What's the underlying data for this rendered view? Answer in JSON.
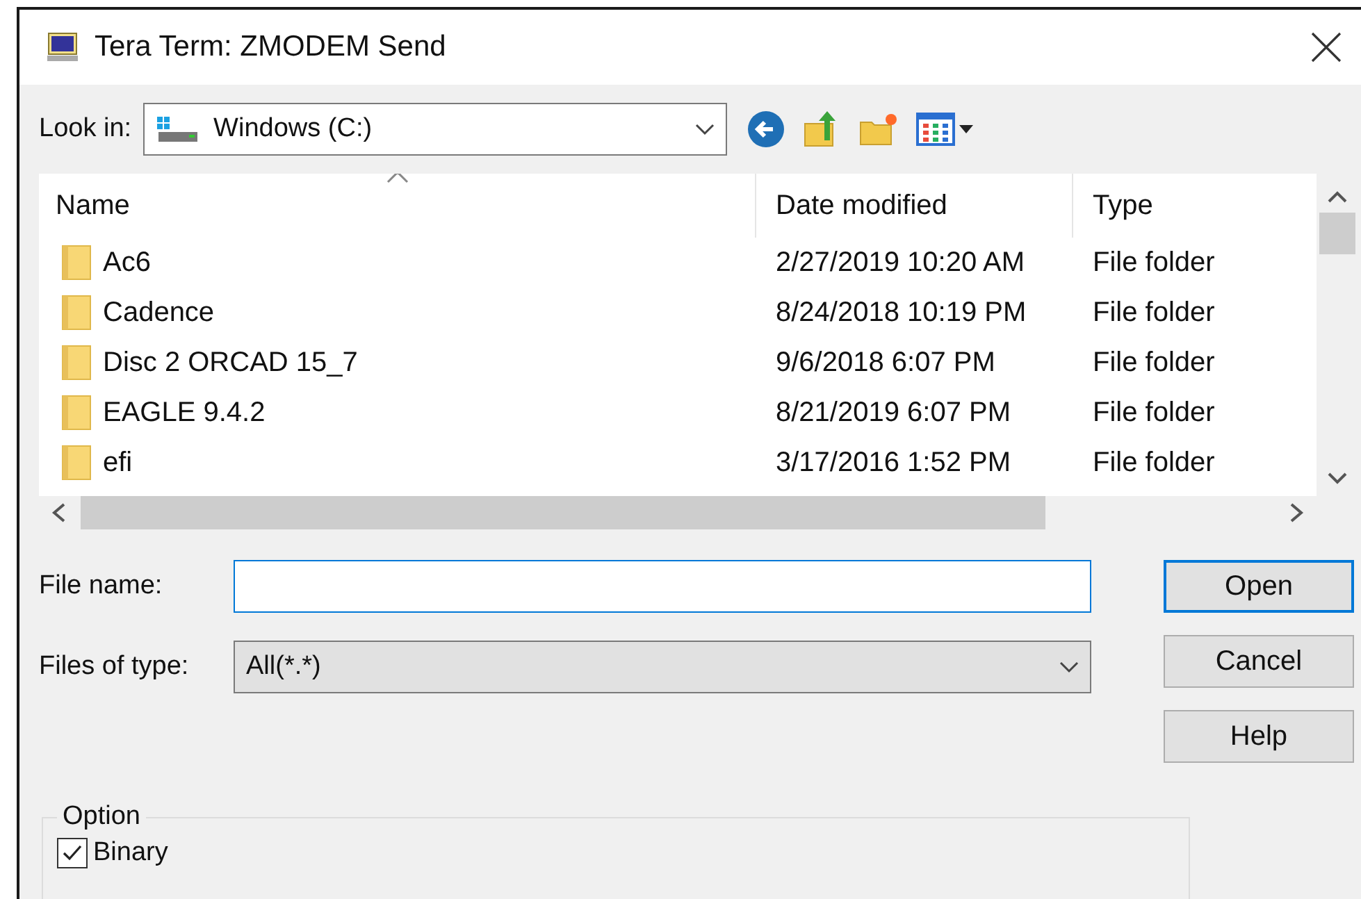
{
  "window": {
    "title": "Tera Term: ZMODEM Send"
  },
  "look_in": {
    "label": "Look in:",
    "value": "Windows (C:)"
  },
  "columns": [
    "Name",
    "Date modified",
    "Type"
  ],
  "rows": [
    {
      "name": "Ac6",
      "date": "2/27/2019 10:20 AM",
      "type": "File folder"
    },
    {
      "name": "Cadence",
      "date": "8/24/2018 10:19 PM",
      "type": "File folder"
    },
    {
      "name": "Disc 2 ORCAD 15_7",
      "date": "9/6/2018 6:07 PM",
      "type": "File folder"
    },
    {
      "name": "EAGLE 9.4.2",
      "date": "8/21/2019 6:07 PM",
      "type": "File folder"
    },
    {
      "name": "efi",
      "date": "3/17/2016 1:52 PM",
      "type": "File folder"
    }
  ],
  "file_name": {
    "label": "File name:"
  },
  "files_of_type": {
    "label": "Files of type:",
    "value": "All(*.*)"
  },
  "buttons": [
    {
      "label": "Open",
      "default": true
    },
    {
      "label": "Cancel",
      "default": false
    },
    {
      "label": "Help",
      "default": false
    }
  ],
  "option": {
    "title": "Option",
    "checkbox": {
      "label": "Binary",
      "checked": true
    }
  }
}
